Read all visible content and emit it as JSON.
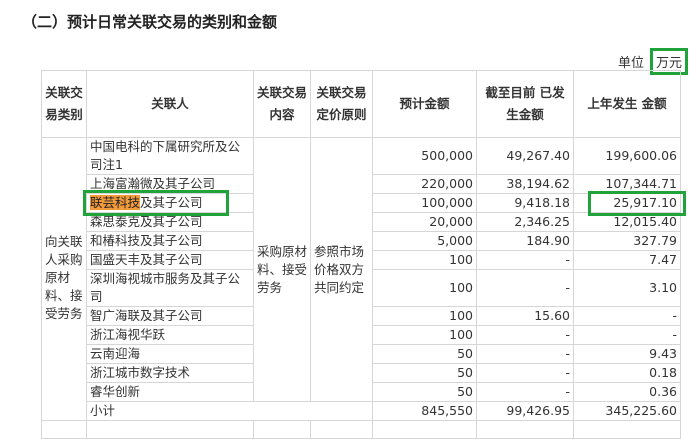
{
  "title": "（二）预计日常关联交易的类别和金额",
  "unit_label": "单位",
  "unit_value": "万元",
  "headers": [
    "关联交易类别",
    "关联人",
    "关联交易内容",
    "关联交易定价原则",
    "预计金额",
    "截至目前 已发生金额",
    "上年发生 金额"
  ],
  "category": "向关联人采购原材料、接受劳务",
  "content": "采购原材料、接受劳务",
  "pricing": "参照市场价格双方共同约定",
  "highlight_term": "联芸科技",
  "highlight_rest": "及其子公司",
  "rows": [
    {
      "party": "中国电科的下属研究所及公司注1",
      "est": "500,000",
      "ytd": "49,267.40",
      "prev": "199,600.06"
    },
    {
      "party": "上海富瀚微及其子公司",
      "est": "220,000",
      "ytd": "38,194.62",
      "prev": "107,344.71"
    },
    {
      "party": "联芸科技及其子公司",
      "est": "100,000",
      "ytd": "9,418.18",
      "prev": "25,917.10"
    },
    {
      "party": "森思泰克及其子公司",
      "est": "20,000",
      "ytd": "2,346.25",
      "prev": "12,015.40"
    },
    {
      "party": "和椿科技及其子公司",
      "est": "5,000",
      "ytd": "184.90",
      "prev": "327.79"
    },
    {
      "party": "国盛天丰及其子公司",
      "est": "100",
      "ytd": "-",
      "prev": "7.47"
    },
    {
      "party": "深圳海视城市服务及其子公司",
      "est": "100",
      "ytd": "-",
      "prev": "3.10"
    },
    {
      "party": "智广海联及其子公司",
      "est": "100",
      "ytd": "15.60",
      "prev": "-"
    },
    {
      "party": "浙江海视华跃",
      "est": "100",
      "ytd": "-",
      "prev": "-"
    },
    {
      "party": "云南迎海",
      "est": "50",
      "ytd": "-",
      "prev": "9.43"
    },
    {
      "party": "浙江城市数字技术",
      "est": "50",
      "ytd": "-",
      "prev": "0.18"
    },
    {
      "party": "睿华创新",
      "est": "50",
      "ytd": "-",
      "prev": "0.36"
    }
  ],
  "subtotal": {
    "label": "小计",
    "est": "845,550",
    "ytd": "99,426.95",
    "prev": "345,225.60"
  }
}
